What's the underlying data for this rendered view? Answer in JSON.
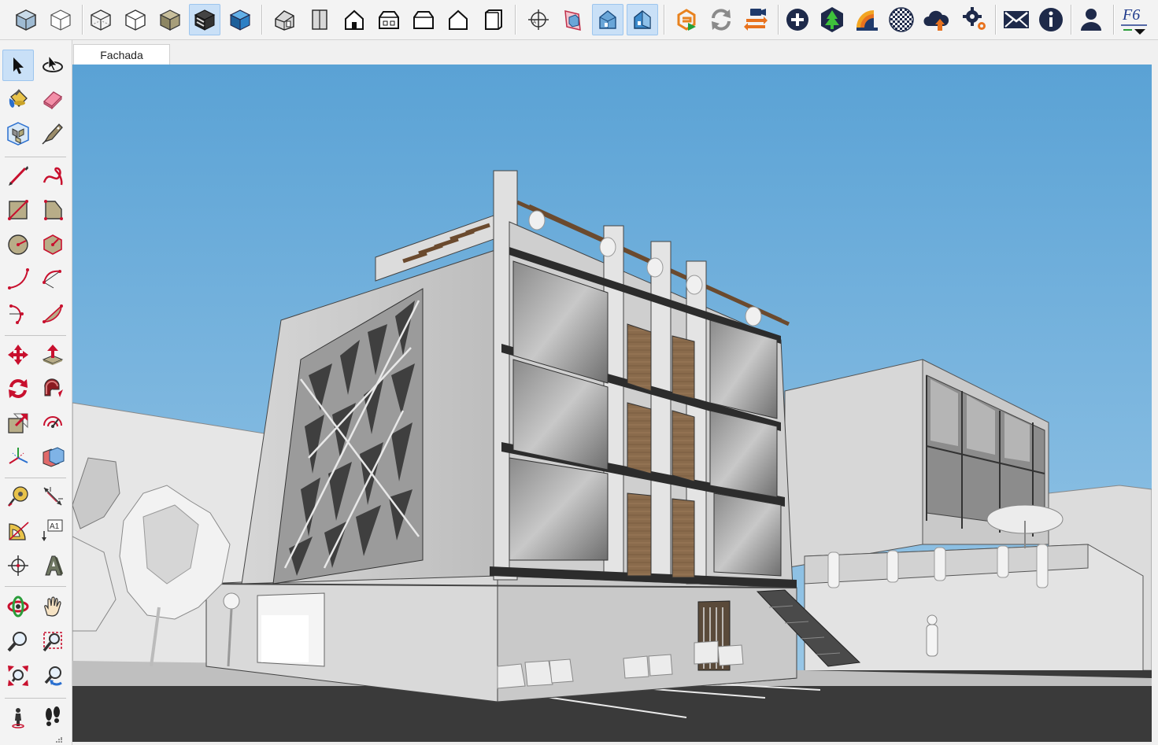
{
  "app": {
    "active_scene_tab": "Fachada",
    "active_tool": "select",
    "sky_color": "#62a7d6",
    "ground_color": "#3a3a3a"
  },
  "top_toolbar": {
    "groups": [
      [
        "iso-view-icon",
        "wireframe-cube-icon"
      ],
      [
        "xray-cube-icon",
        "hidden-line-cube-icon",
        "shaded-cube-icon",
        "shaded-textures-icon",
        "monochrome-icon"
      ],
      [
        "iso-house-icon",
        "top-view-icon",
        "front-view-icon",
        "right-view-icon",
        "back-view-icon",
        "left-view-icon",
        "bottom-view-icon"
      ],
      [
        "section-plane-icon",
        "display-section-planes-icon",
        "display-section-cuts-icon",
        "section-fill-icon"
      ],
      [
        "extension-warehouse-icon",
        "refresh-icon",
        "camera-transfer-icon",
        "add-location-icon",
        "tree-icon",
        "rainbow-chart-icon",
        "checker-sphere-icon",
        "upload-cloud-icon",
        "settings-gears-icon",
        "email-icon",
        "info-icon",
        "user-icon",
        "f6-plugin-icon"
      ]
    ],
    "active": [
      "shaded-textures-icon",
      "display-section-cuts-icon",
      "section-fill-icon"
    ],
    "f6_label": "F6"
  },
  "left_toolbar": {
    "items": [
      "select-tool-icon",
      "orbit-select-icon",
      "paint-bucket-icon",
      "eraser-icon",
      "component-icon",
      "tag-tool-icon",
      "pencil-line-icon",
      "freehand-icon",
      "rectangle-icon",
      "rotated-rectangle-icon",
      "circle-icon",
      "polygon-icon",
      "arc-icon",
      "two-point-arc-icon",
      "three-point-arc-icon",
      "pie-icon",
      "move-icon",
      "push-pull-icon",
      "rotate-icon",
      "follow-me-icon",
      "scale-icon",
      "offset-icon",
      "axes-icon",
      "solid-tools-icon",
      "tape-measure-icon",
      "dimension-icon",
      "protractor-icon",
      "text-label-icon",
      "axes-tool-icon",
      "three-d-text-icon",
      "orbit-icon",
      "pan-hand-icon",
      "zoom-icon",
      "zoom-window-icon",
      "zoom-extents-icon",
      "previous-view-icon",
      "position-camera-icon",
      "walk-icon"
    ],
    "text_label_glyph": "A1"
  }
}
